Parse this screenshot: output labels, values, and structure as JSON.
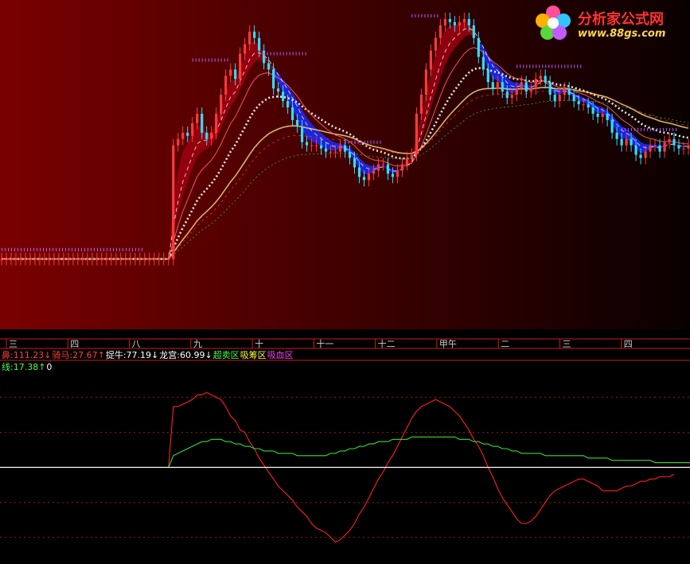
{
  "logo": {
    "title": "分析家公式网",
    "url": "www.88gs.com"
  },
  "axis_labels": [
    "三",
    "四",
    "八",
    "九",
    "十",
    "十一",
    "十二",
    "甲午",
    "二",
    "三",
    "四"
  ],
  "indicator_row1": [
    {
      "name": "鼻",
      "value": "111.23",
      "arrow": "↓",
      "color": "#ff4040"
    },
    {
      "name": "骑马",
      "value": "27.67",
      "arrow": "↑",
      "color": "#ff4040"
    },
    {
      "name": "捉牛",
      "value": "77.19",
      "arrow": "↓",
      "color": "#ffffff"
    },
    {
      "name": "龙宫",
      "value": "60.99",
      "arrow": "↓",
      "color": "#ffffff"
    },
    {
      "name": "超卖区",
      "value": "",
      "arrow": "",
      "color": "#40ff40"
    },
    {
      "name": "吸筹区",
      "value": "",
      "arrow": "",
      "color": "#ffff40"
    },
    {
      "name": "吸血区",
      "value": "",
      "arrow": "",
      "color": "#ff40ff"
    }
  ],
  "indicator_row2": [
    {
      "name": "线",
      "value": "17.38",
      "arrow": "↑",
      "color": "#40ff40"
    },
    {
      "name": "",
      "value": "0",
      "arrow": "",
      "color": "#ffffff"
    }
  ],
  "colors": {
    "bg_top": "#6e0000",
    "bg_bottom": "#000000",
    "candle_up": "#ff3a3a",
    "candle_down": "#33ddff",
    "ribbon_up": "#a00010",
    "ribbon_down": "#1a2cff",
    "osc_red": "#ff2020",
    "osc_green": "#33dd33"
  },
  "chart_data": [
    {
      "type": "candlestick",
      "title": "",
      "ylim": [
        0,
        100
      ],
      "price": [
        20,
        20,
        20,
        20,
        20,
        20,
        20,
        20,
        20,
        20,
        20,
        20,
        20,
        20,
        20,
        20,
        20,
        20,
        20,
        20,
        20,
        20,
        20,
        20,
        20,
        20,
        20,
        20,
        20,
        20,
        20,
        20,
        20,
        20,
        20,
        20,
        56,
        58,
        60,
        59,
        63,
        66,
        60,
        58,
        60,
        66,
        72,
        78,
        80,
        77,
        85,
        88,
        92,
        90,
        86,
        82,
        80,
        74,
        73,
        70,
        68,
        64,
        62,
        57,
        56,
        56,
        56,
        55,
        54,
        54,
        54,
        56,
        54,
        52,
        49,
        46,
        45,
        47,
        48,
        50,
        50,
        47,
        46,
        48,
        50,
        52,
        53,
        66,
        72,
        80,
        86,
        90,
        94,
        96,
        95,
        94,
        95,
        96,
        94,
        90,
        84,
        80,
        76,
        74,
        76,
        73,
        71,
        72,
        74,
        76,
        73,
        74,
        77,
        78,
        76,
        72,
        70,
        72,
        74,
        72,
        70,
        69,
        69,
        68,
        66,
        65,
        66,
        64,
        60,
        58,
        56,
        58,
        56,
        53,
        52,
        54,
        56,
        56,
        54,
        57,
        58,
        56,
        55,
        55,
        56
      ]
    },
    {
      "type": "line",
      "title": "",
      "ylim": [
        -40,
        40
      ],
      "series": [
        {
          "color": "#ff2020",
          "values": [
            0,
            0,
            0,
            0,
            0,
            0,
            0,
            0,
            0,
            0,
            0,
            0,
            0,
            0,
            0,
            0,
            0,
            0,
            0,
            0,
            0,
            0,
            0,
            0,
            0,
            0,
            0,
            0,
            0,
            0,
            0,
            0,
            0,
            0,
            0,
            0,
            26,
            26,
            27,
            28,
            29,
            31,
            31,
            32,
            31,
            30,
            29,
            26,
            22,
            20,
            16,
            15,
            11,
            8,
            4,
            1,
            -2,
            -5,
            -8,
            -10,
            -12,
            -14,
            -17,
            -19,
            -21,
            -24,
            -26,
            -27,
            -28,
            -30,
            -32,
            -31,
            -29,
            -27,
            -24,
            -20,
            -17,
            -13,
            -9,
            -5,
            -2,
            2,
            5,
            9,
            13,
            17,
            21,
            24,
            26,
            27,
            28,
            29,
            28,
            27,
            26,
            24,
            22,
            19,
            16,
            12,
            9,
            5,
            0,
            -4,
            -9,
            -13,
            -16,
            -19,
            -22,
            -24,
            -24,
            -23,
            -21,
            -18,
            -15,
            -12,
            -10,
            -9,
            -8,
            -7,
            -6,
            -5,
            -5,
            -6,
            -7,
            -8,
            -10,
            -10,
            -10,
            -10,
            -9,
            -8,
            -8,
            -7,
            -6,
            -6,
            -5,
            -5,
            -4,
            -4,
            -4,
            -3
          ]
        },
        {
          "color": "#33dd33",
          "values": [
            0,
            0,
            0,
            0,
            0,
            0,
            0,
            0,
            0,
            0,
            0,
            0,
            0,
            0,
            0,
            0,
            0,
            0,
            0,
            0,
            0,
            0,
            0,
            0,
            0,
            0,
            0,
            0,
            0,
            0,
            0,
            0,
            0,
            0,
            0,
            0,
            5,
            6,
            7,
            8,
            9,
            10,
            11,
            11,
            12,
            12,
            12,
            11,
            11,
            10,
            10,
            9,
            9,
            8,
            8,
            7,
            7,
            7,
            6,
            6,
            6,
            6,
            5,
            5,
            5,
            5,
            5,
            5,
            5,
            6,
            6,
            7,
            7,
            8,
            8,
            9,
            9,
            10,
            10,
            11,
            11,
            11,
            12,
            12,
            12,
            12,
            13,
            13,
            13,
            13,
            13,
            13,
            13,
            13,
            13,
            13,
            12,
            12,
            12,
            11,
            11,
            10,
            10,
            9,
            9,
            8,
            8,
            7,
            7,
            6,
            6,
            6,
            6,
            6,
            5,
            5,
            5,
            5,
            5,
            5,
            5,
            5,
            5,
            4,
            4,
            4,
            4,
            4,
            3,
            3,
            3,
            3,
            3,
            3,
            3,
            3,
            3,
            2,
            2,
            2,
            2,
            2,
            2,
            2,
            2,
            2
          ]
        },
        {
          "color": "#ffffff",
          "values": [
            0
          ]
        }
      ]
    }
  ]
}
